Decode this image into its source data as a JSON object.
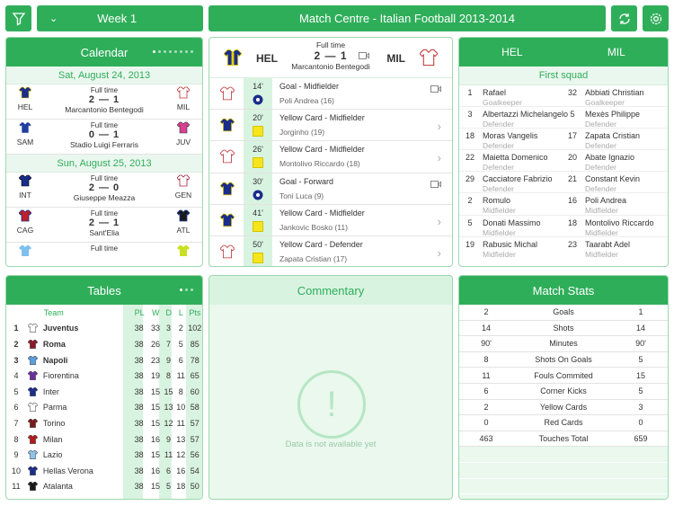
{
  "topbar": {
    "week": "Week 1",
    "title": "Match Centre - Italian Football 2013-2014"
  },
  "calendar": {
    "title": "Calendar",
    "days": [
      {
        "date": "Sat, August 24, 2013",
        "matches": [
          {
            "home": "HEL",
            "away": "MIL",
            "status": "Full time",
            "score": "2 — 1",
            "venue": "Marcantonio Bentegodi"
          },
          {
            "home": "SAM",
            "away": "JUV",
            "status": "Full time",
            "score": "0 — 1",
            "venue": "Stadio Luigi Ferraris"
          }
        ]
      },
      {
        "date": "Sun, August 25, 2013",
        "matches": [
          {
            "home": "INT",
            "away": "GEN",
            "status": "Full time",
            "score": "2 — 0",
            "venue": "Giuseppe Meazza"
          },
          {
            "home": "CAG",
            "away": "ATL",
            "status": "Full time",
            "score": "2 — 1",
            "venue": "Sant'Elia"
          },
          {
            "home": "",
            "away": "",
            "status": "Full time",
            "score": "",
            "venue": ""
          }
        ]
      }
    ]
  },
  "match": {
    "home": "HEL",
    "away": "MIL",
    "status": "Full time",
    "score": "2 — 1",
    "venue": "Marcantonio Bentegodi",
    "events": [
      {
        "side": "away",
        "minute": "14'",
        "type": "Goal - Midfielder",
        "player": "Poli Andrea (16)",
        "icon": "ball",
        "action": "video"
      },
      {
        "side": "home",
        "minute": "20'",
        "type": "Yellow Card - Midfielder",
        "player": "Jorginho (19)",
        "icon": "yellow-card",
        "action": "chevron"
      },
      {
        "side": "away",
        "minute": "26'",
        "type": "Yellow Card - Midfielder",
        "player": "Montolivo Riccardo (18)",
        "icon": "yellow-card",
        "action": "chevron"
      },
      {
        "side": "home",
        "minute": "30'",
        "type": "Goal - Forward",
        "player": "Toni Luca (9)",
        "icon": "ball",
        "action": "video"
      },
      {
        "side": "home",
        "minute": "41'",
        "type": "Yellow Card - Midfielder",
        "player": "Jankovic Bosko (11)",
        "icon": "yellow-card",
        "action": "chevron"
      },
      {
        "side": "away",
        "minute": "50'",
        "type": "Yellow Card - Defender",
        "player": "Zapata Cristian (17)",
        "icon": "yellow-card",
        "action": "chevron"
      }
    ]
  },
  "lineups": {
    "home": "HEL",
    "away": "MIL",
    "section": "First squad",
    "rows": [
      {
        "hn": "1",
        "hp": "Rafael",
        "hpos": "Goalkeeper",
        "an": "32",
        "ap": "Abbiati Christian",
        "apos": "Goalkeeper"
      },
      {
        "hn": "3",
        "hp": "Albertazzi Michelangelo",
        "hpos": "Defender",
        "an": "5",
        "ap": "Mexès Philippe",
        "apos": "Defender"
      },
      {
        "hn": "18",
        "hp": "Moras Vangelis",
        "hpos": "Defender",
        "an": "17",
        "ap": "Zapata Cristian",
        "apos": "Defender"
      },
      {
        "hn": "22",
        "hp": "Maietta Domenico",
        "hpos": "Defender",
        "an": "20",
        "ap": "Abate Ignazio",
        "apos": "Defender"
      },
      {
        "hn": "29",
        "hp": "Cacciatore Fabrizio",
        "hpos": "Defender",
        "an": "21",
        "ap": "Constant Kevin",
        "apos": "Defender"
      },
      {
        "hn": "2",
        "hp": "Romulo",
        "hpos": "Midfielder",
        "an": "16",
        "ap": "Poli Andrea",
        "apos": "Midfielder"
      },
      {
        "hn": "5",
        "hp": "Donati Massimo",
        "hpos": "Midfielder",
        "an": "18",
        "ap": "Montolivo Riccardo",
        "apos": "Midfielder"
      },
      {
        "hn": "19",
        "hp": "Rabusic Michal",
        "hpos": "Midfielder",
        "an": "23",
        "ap": "Taarabt Adel",
        "apos": "Midfielder"
      }
    ]
  },
  "tables": {
    "title": "Tables",
    "headers": {
      "team": "Team",
      "pl": "PL",
      "w": "W",
      "d": "D",
      "l": "L",
      "pts": "Pts"
    },
    "rows": [
      {
        "pos": "1",
        "team": "Juventus",
        "pl": "38",
        "w": "33",
        "d": "3",
        "l": "2",
        "pts": "102",
        "bold": true,
        "color": "#ffffff"
      },
      {
        "pos": "2",
        "team": "Roma",
        "pl": "38",
        "w": "26",
        "d": "7",
        "l": "5",
        "pts": "85",
        "bold": true,
        "color": "#8b1a2b"
      },
      {
        "pos": "3",
        "team": "Napoli",
        "pl": "38",
        "w": "23",
        "d": "9",
        "l": "6",
        "pts": "78",
        "bold": true,
        "color": "#5aa0e0"
      },
      {
        "pos": "4",
        "team": "Fiorentina",
        "pl": "38",
        "w": "19",
        "d": "8",
        "l": "11",
        "pts": "65",
        "bold": false,
        "color": "#6b2fa0"
      },
      {
        "pos": "5",
        "team": "Inter",
        "pl": "38",
        "w": "15",
        "d": "15",
        "l": "8",
        "pts": "60",
        "bold": false,
        "color": "#1a2d8b"
      },
      {
        "pos": "6",
        "team": "Parma",
        "pl": "38",
        "w": "15",
        "d": "13",
        "l": "10",
        "pts": "58",
        "bold": false,
        "color": "#ffffff"
      },
      {
        "pos": "7",
        "team": "Torino",
        "pl": "38",
        "w": "15",
        "d": "12",
        "l": "11",
        "pts": "57",
        "bold": false,
        "color": "#7a1a1a"
      },
      {
        "pos": "8",
        "team": "Milan",
        "pl": "38",
        "w": "16",
        "d": "9",
        "l": "13",
        "pts": "57",
        "bold": false,
        "color": "#b01c1c"
      },
      {
        "pos": "9",
        "team": "Lazio",
        "pl": "38",
        "w": "15",
        "d": "11",
        "l": "12",
        "pts": "56",
        "bold": false,
        "color": "#8ec5ea"
      },
      {
        "pos": "10",
        "team": "Hellas Verona",
        "pl": "38",
        "w": "16",
        "d": "6",
        "l": "16",
        "pts": "54",
        "bold": false,
        "color": "#1a2d8b"
      },
      {
        "pos": "11",
        "team": "Atalanta",
        "pl": "38",
        "w": "15",
        "d": "5",
        "l": "18",
        "pts": "50",
        "bold": false,
        "color": "#1a1a1a"
      }
    ]
  },
  "commentary": {
    "title": "Commentary",
    "empty": "Data is not available yet"
  },
  "stats": {
    "title": "Match Stats",
    "rows": [
      {
        "h": "2",
        "label": "Goals",
        "a": "1"
      },
      {
        "h": "14",
        "label": "Shots",
        "a": "14"
      },
      {
        "h": "90'",
        "label": "Minutes",
        "a": "90'"
      },
      {
        "h": "8",
        "label": "Shots On Goals",
        "a": "5"
      },
      {
        "h": "11",
        "label": "Fouls Commited",
        "a": "15"
      },
      {
        "h": "6",
        "label": "Corner Kicks",
        "a": "5"
      },
      {
        "h": "2",
        "label": "Yellow Cards",
        "a": "3"
      },
      {
        "h": "0",
        "label": "Red Cards",
        "a": "0"
      },
      {
        "h": "463",
        "label": "Touches Total",
        "a": "659"
      }
    ]
  },
  "colors": {
    "accent": "#2fae5a",
    "light": "#d9f3e1",
    "hel": "#1a2d8b",
    "mil": "#ffffff"
  }
}
